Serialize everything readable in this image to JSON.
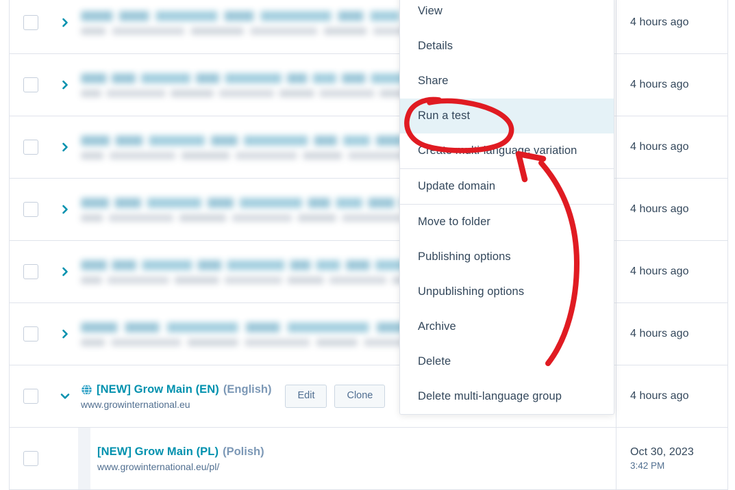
{
  "table": {
    "rows": [
      {
        "type": "redacted",
        "width_class": "b-w1",
        "expanded": false,
        "date": "4 hours ago",
        "time": ""
      },
      {
        "type": "redacted",
        "width_class": "b-w2",
        "expanded": false,
        "date": "4 hours ago",
        "time": ""
      },
      {
        "type": "redacted",
        "width_class": "b-w3",
        "expanded": false,
        "date": "4 hours ago",
        "time": ""
      },
      {
        "type": "redacted",
        "width_class": "b-w4",
        "expanded": false,
        "date": "4 hours ago",
        "time": ""
      },
      {
        "type": "redacted",
        "width_class": "b-w5",
        "expanded": false,
        "date": "4 hours ago",
        "time": ""
      },
      {
        "type": "redacted",
        "width_class": "b-w6",
        "expanded": false,
        "date": "4 hours ago",
        "time": ""
      }
    ],
    "parent_row": {
      "title": "[NEW] Grow Main (EN)",
      "language": "(English)",
      "url": "www.growinternational.eu",
      "date": "4 hours ago",
      "time": "",
      "edit_label": "Edit",
      "clone_label": "Clone",
      "globe_icon": "globe-icon",
      "chevron_icon": "chevron-down-icon"
    },
    "child_row": {
      "title": "[NEW] Grow Main (PL)",
      "language": "(Polish)",
      "url": "www.growinternational.eu/pl/",
      "date": "Oct 30, 2023",
      "time": "3:42 PM"
    }
  },
  "menu": {
    "groups": [
      {
        "items": [
          {
            "label": "View",
            "highlighted": false
          },
          {
            "label": "Details",
            "highlighted": false
          },
          {
            "label": "Share",
            "highlighted": false
          },
          {
            "label": "Run a test",
            "highlighted": true
          },
          {
            "label": "Create multi-language variation",
            "highlighted": false
          }
        ]
      },
      {
        "items": [
          {
            "label": "Update domain",
            "highlighted": false
          }
        ]
      },
      {
        "items": [
          {
            "label": "Move to folder",
            "highlighted": false
          },
          {
            "label": "Publishing options",
            "highlighted": false
          },
          {
            "label": "Unpublishing options",
            "highlighted": false
          },
          {
            "label": "Archive",
            "highlighted": false
          },
          {
            "label": "Delete",
            "highlighted": false
          },
          {
            "label": "Delete multi-language group",
            "highlighted": false
          }
        ]
      }
    ]
  },
  "annotation": {
    "color": "#e01b22",
    "shapes": [
      "ellipse-around-run-a-test",
      "curved-arrow-pointing-to-run-a-test"
    ]
  },
  "colors": {
    "link": "#0091ae",
    "text": "#33475b",
    "muted": "#516f90",
    "border": "#dfe3eb",
    "highlight": "#e5f2f7",
    "annotation_red": "#e01b22"
  }
}
